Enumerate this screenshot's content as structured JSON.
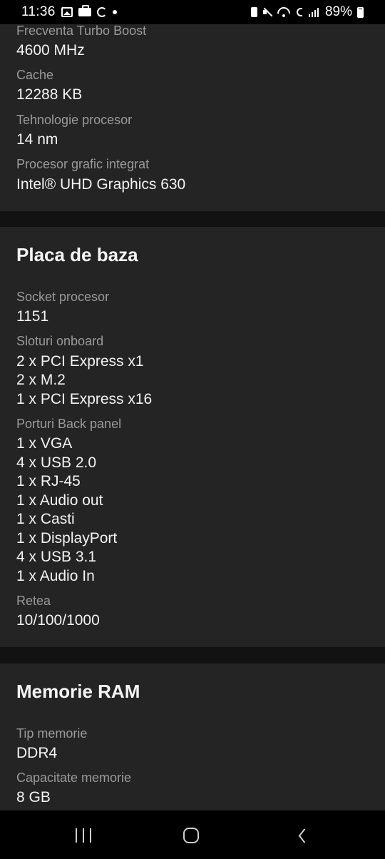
{
  "status_bar": {
    "time": "11:36",
    "battery_text": "89%"
  },
  "cpu_continued": {
    "fields": [
      {
        "label": "Frecventa Turbo Boost",
        "value": "4600 MHz"
      },
      {
        "label": "Cache",
        "value": "12288 KB"
      },
      {
        "label": "Tehnologie procesor",
        "value": "14 nm"
      },
      {
        "label": "Procesor grafic integrat",
        "value": "Intel® UHD Graphics 630"
      }
    ]
  },
  "placa_de_baza": {
    "title": "Placa de baza",
    "socket_label": "Socket procesor",
    "socket_value": "1151",
    "sloturi_label": "Sloturi onboard",
    "sloturi_values": [
      "2 x PCI Express x1",
      "2 x M.2",
      "1 x PCI Express x16"
    ],
    "porturi_label": "Porturi Back panel",
    "porturi_values": [
      "1 x VGA",
      "4 x USB 2.0",
      "1 x RJ-45",
      "1 x Audio out",
      "1 x Casti",
      "1 x DisplayPort",
      "4 x USB 3.1",
      "1 x Audio In"
    ],
    "retea_label": "Retea",
    "retea_value": "10/100/1000"
  },
  "memorie_ram": {
    "title": "Memorie RAM",
    "fields": [
      {
        "label": "Tip memorie",
        "value": "DDR4"
      },
      {
        "label": "Capacitate memorie",
        "value": "8 GB"
      }
    ]
  },
  "icons": {
    "status_left": [
      "gallery-icon",
      "bag-icon",
      "sync-icon",
      "dot-icon"
    ],
    "status_right": [
      "battery-saver-icon",
      "mute-icon",
      "wifi-icon",
      "wifi-calling-icon",
      "signal-icon",
      "battery-icon"
    ],
    "nav": [
      "recent-apps-icon",
      "home-icon",
      "back-icon"
    ]
  },
  "colors": {
    "section_bg": "#242424",
    "divider_bg": "#121212",
    "label": "#9a9a9a",
    "value": "#f3f3f3"
  }
}
